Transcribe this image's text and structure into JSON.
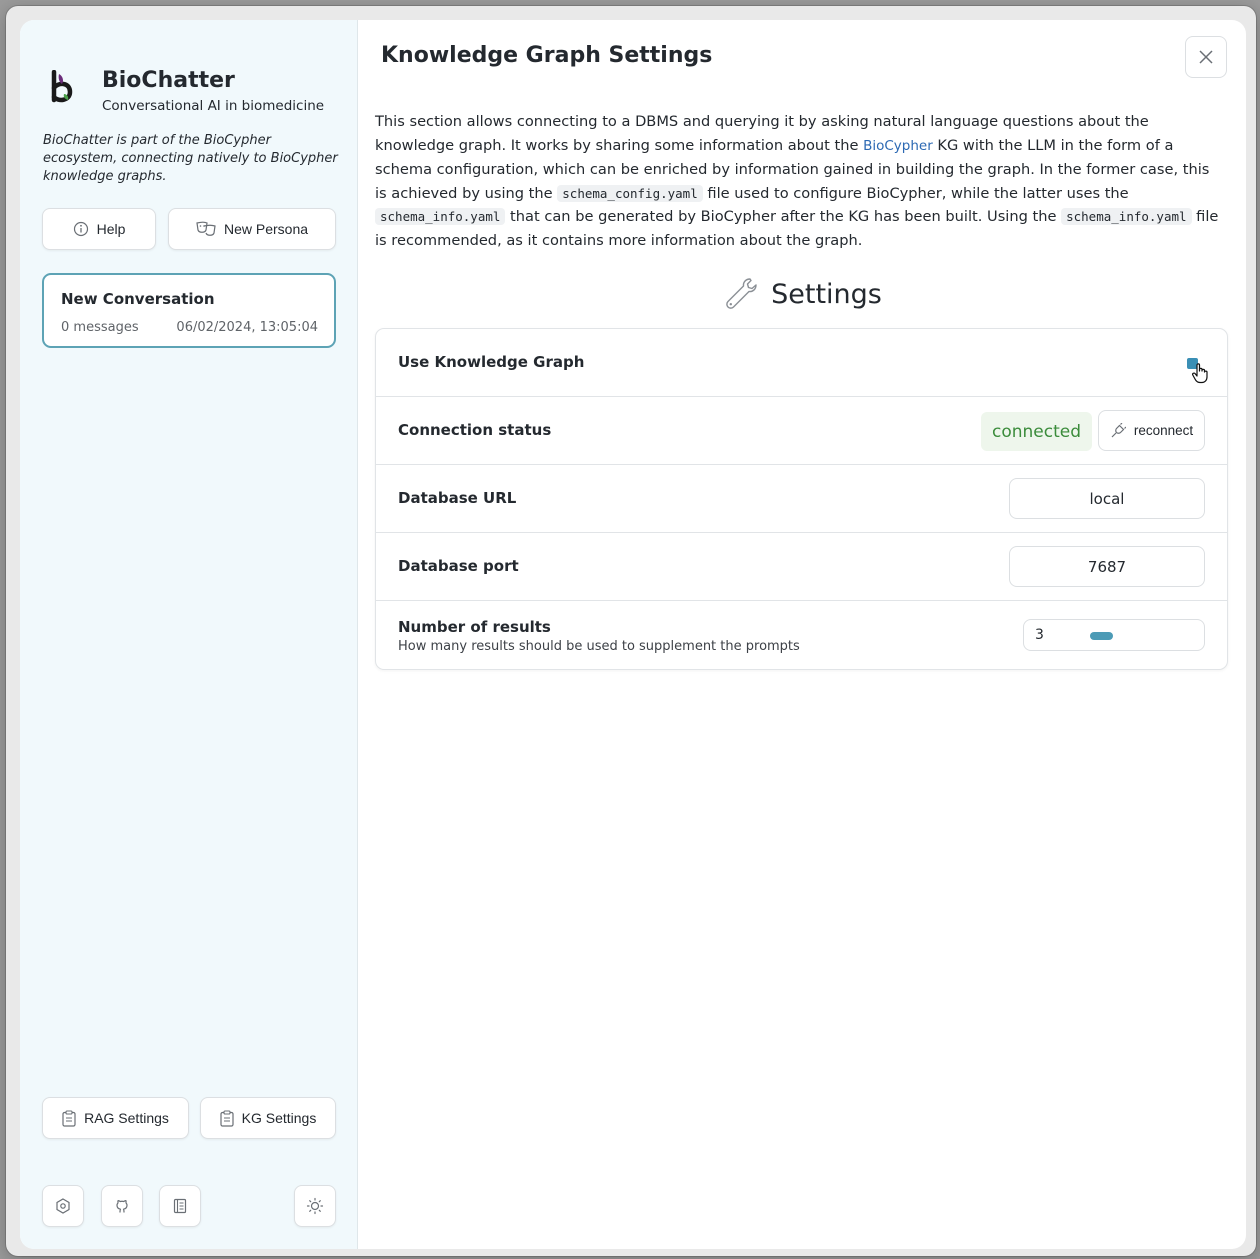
{
  "sidebar": {
    "app_name": "BioChatter",
    "tagline": "Conversational AI in biomedicine",
    "description": "BioChatter is part of the BioCypher ecosystem, connecting natively to BioCypher knowledge graphs.",
    "help_label": "Help",
    "new_persona_label": "New Persona",
    "conversation": {
      "title": "New Conversation",
      "count": "0 messages",
      "date": "06/02/2024, 13:05:04"
    },
    "rag_settings_label": "RAG Settings",
    "kg_settings_label": "KG Settings",
    "footer_icons": [
      "settings-hex-icon",
      "github-icon",
      "docs-icon",
      "sun-icon"
    ]
  },
  "main": {
    "title": "Knowledge Graph Settings",
    "intro": {
      "p1": "This section allows connecting to a DBMS and querying it by asking natural language questions about the knowledge graph. It works by sharing some information about the ",
      "link": "BioCypher",
      "p2": " KG with the LLM in the form of a schema configuration, which can be enriched by information gained in building the graph. In the former case, this is achieved by using the ",
      "code1": "schema_config.yaml",
      "p3": " file used to configure BioCypher, while the latter uses the ",
      "code2": "schema_info.yaml",
      "p4": " that can be generated by BioCypher after the KG has been built. Using the ",
      "code3": "schema_info.yaml",
      "p5": " file is recommended, as it contains more information about the graph."
    },
    "settings_heading": "Settings",
    "settings": {
      "use_kg": {
        "label": "Use Knowledge Graph",
        "checked": true
      },
      "connection": {
        "label": "Connection status",
        "status": "connected",
        "reconnect_label": "reconnect"
      },
      "db_url": {
        "label": "Database URL",
        "value": "local"
      },
      "db_port": {
        "label": "Database port",
        "value": "7687"
      },
      "num_results": {
        "label": "Number of results",
        "hint": "How many results should be used to supplement the prompts",
        "value": "3"
      }
    }
  },
  "colors": {
    "accent": "#4c9bb6",
    "sidebar_bg": "#f1f9fc",
    "connected_text": "#3b8c3b",
    "connected_bg": "#eef6ec",
    "link": "#2c69b3"
  }
}
